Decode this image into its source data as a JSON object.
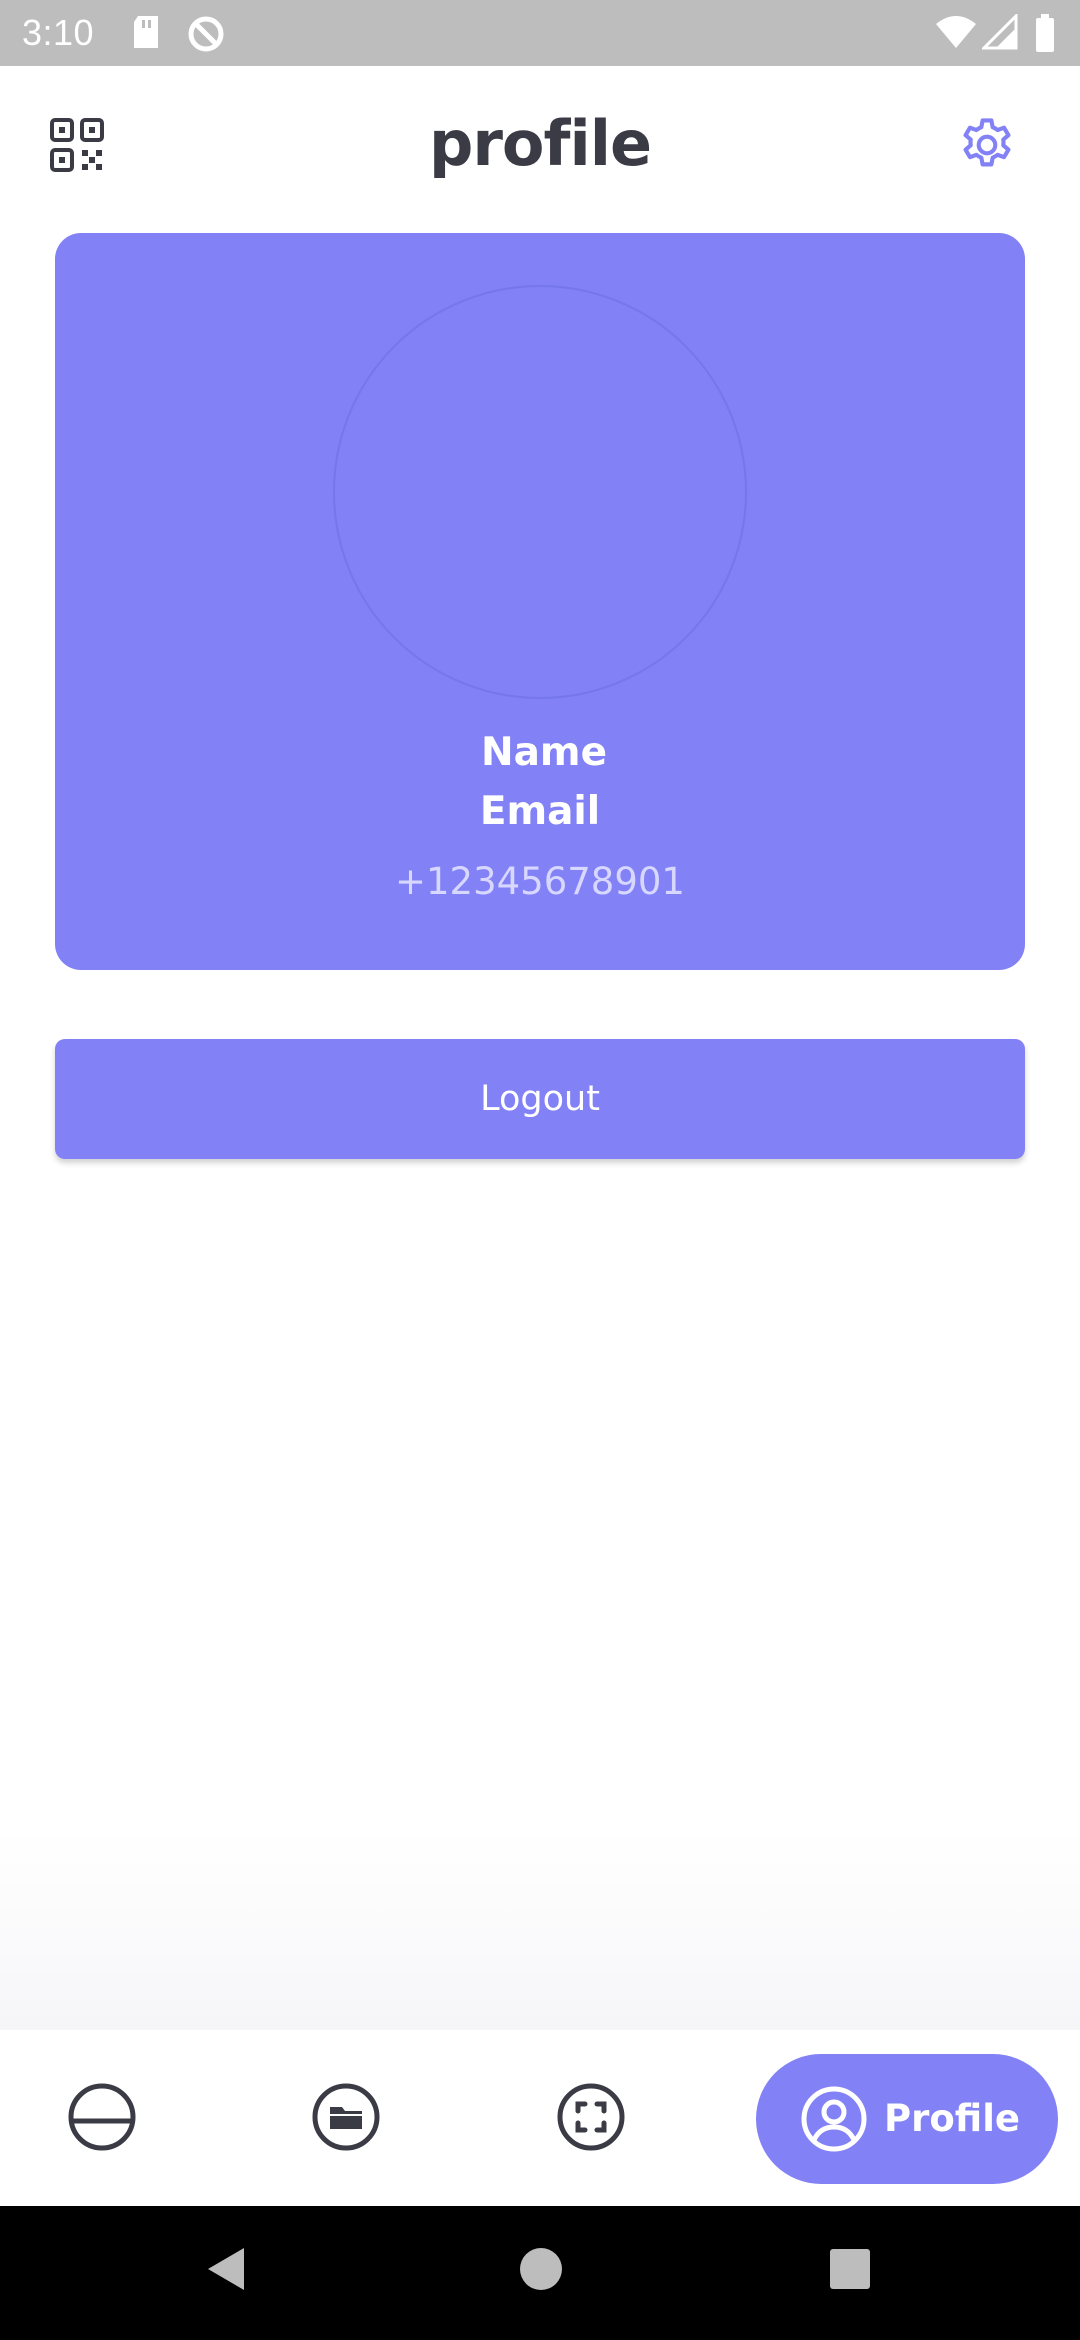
{
  "status_bar": {
    "time": "3:10",
    "icons": [
      "sd-card-icon",
      "sync-disabled-icon",
      "wifi-icon",
      "signal-icon",
      "battery-icon"
    ]
  },
  "header": {
    "title": "profile",
    "left_icon": "qr-code-icon",
    "right_icon": "gear-icon",
    "accent_color": "#8282f6"
  },
  "profile_card": {
    "name": "Name",
    "email": "Email",
    "phone": "+12345678901",
    "background": "#8282f6"
  },
  "logout": {
    "label": "Logout"
  },
  "bottom_nav": {
    "items": [
      {
        "icon": "half-circle-icon",
        "label": ""
      },
      {
        "icon": "folder-icon",
        "label": ""
      },
      {
        "icon": "scan-icon",
        "label": ""
      },
      {
        "icon": "user-circle-icon",
        "label": "Profile",
        "active": true
      }
    ]
  },
  "system_nav": {
    "buttons": [
      "back-icon",
      "home-icon",
      "recents-icon"
    ]
  }
}
